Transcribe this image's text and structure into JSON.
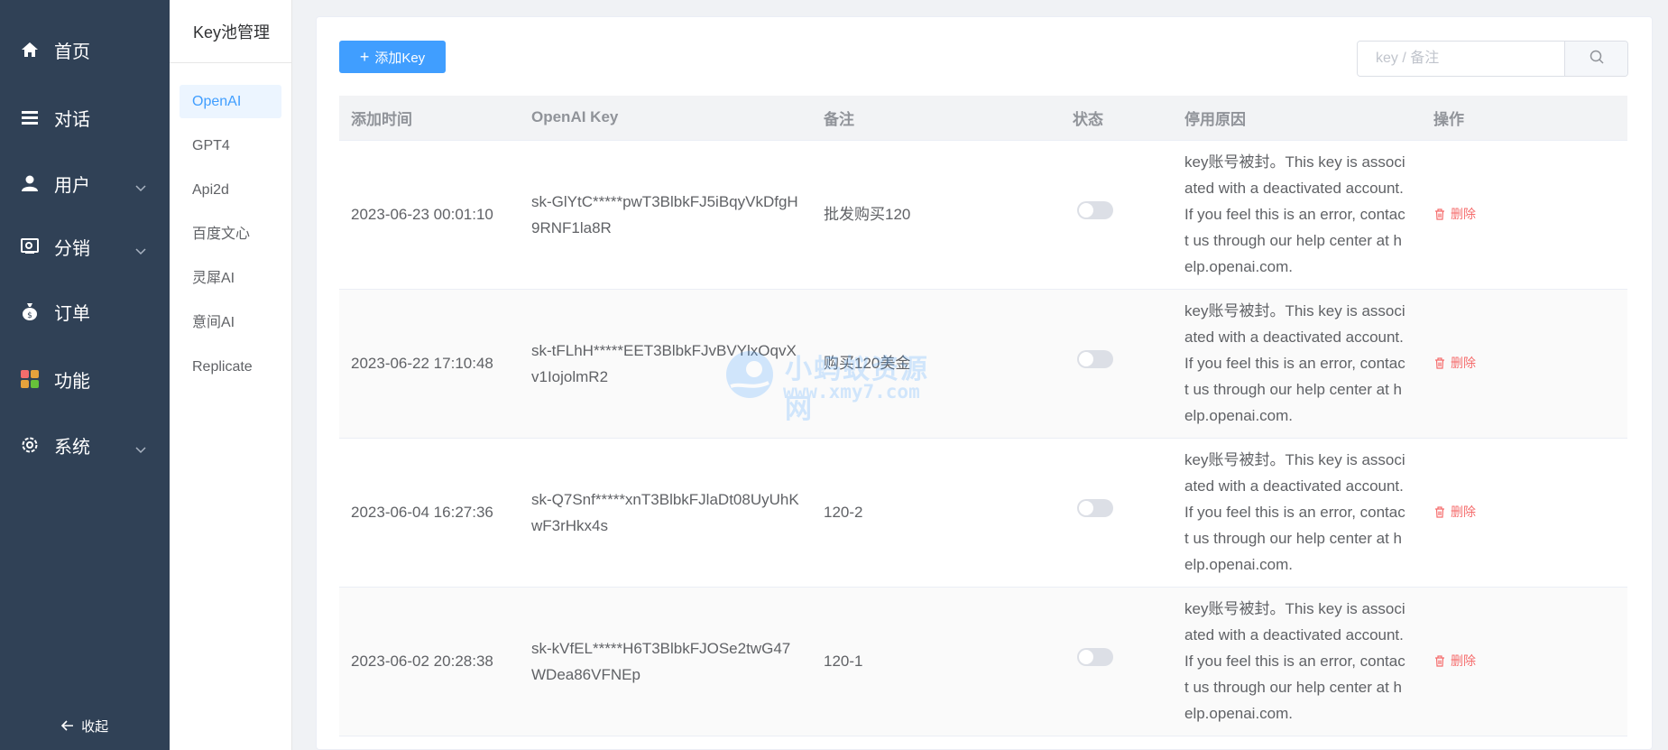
{
  "sidebar": {
    "items": [
      {
        "label": "首页",
        "icon": "home-icon"
      },
      {
        "label": "对话",
        "icon": "list-icon"
      },
      {
        "label": "用户",
        "icon": "user-icon"
      },
      {
        "label": "分销",
        "icon": "distribution-icon"
      },
      {
        "label": "订单",
        "icon": "money-bag-icon"
      },
      {
        "label": "功能",
        "icon": "apps-icon"
      },
      {
        "label": "系统",
        "icon": "gear-icon"
      }
    ],
    "collapse_label": "收起"
  },
  "subnav": {
    "title": "Key池管理",
    "items": [
      "OpenAI",
      "GPT4",
      "Api2d",
      "百度文心",
      "灵犀AI",
      "意间AI",
      "Replicate"
    ],
    "active": "OpenAI"
  },
  "toolbar": {
    "add_label": "添加Key",
    "search_placeholder": "key / 备注"
  },
  "table": {
    "headers": [
      "添加时间",
      "OpenAI Key",
      "备注",
      "状态",
      "停用原因",
      "操作"
    ],
    "delete_label": "删除",
    "rows": [
      {
        "time": "2023-06-23 00:01:10",
        "key": "sk-GlYtC*****pwT3BlbkFJ5iBqyVkDfgH9RNF1la8R",
        "note": "批发购买120",
        "status": "off",
        "reason": "key账号被封。This key is associated with a deactivated account. If you feel this is an error, contact us through our help center at help.openai.com."
      },
      {
        "time": "2023-06-22 17:10:48",
        "key": "sk-tFLhH*****EET3BlbkFJvBVYlxOqvXv1IojolmR2",
        "note": "购买120美金",
        "status": "off",
        "reason": "key账号被封。This key is associated with a deactivated account. If you feel this is an error, contact us through our help center at help.openai.com."
      },
      {
        "time": "2023-06-04 16:27:36",
        "key": "sk-Q7Snf*****xnT3BlbkFJlaDt08UyUhKwF3rHkx4s",
        "note": "120-2",
        "status": "off",
        "reason": "key账号被封。This key is associated with a deactivated account. If you feel this is an error, contact us through our help center at help.openai.com."
      },
      {
        "time": "2023-06-02 20:28:38",
        "key": "sk-kVfEL*****H6T3BlbkFJOSe2twG47WDea86VFNEp",
        "note": "120-1",
        "status": "off",
        "reason": "key账号被封。This key is associated with a deactivated account. If you feel this is an error, contact us through our help center at help.openai.com."
      }
    ]
  },
  "watermark": {
    "title": "小蚂蚁资源网",
    "url": "www.xmy7.com"
  },
  "colors": {
    "sidebar_bg": "#304156",
    "primary": "#409eff",
    "danger": "#f56c6c"
  }
}
